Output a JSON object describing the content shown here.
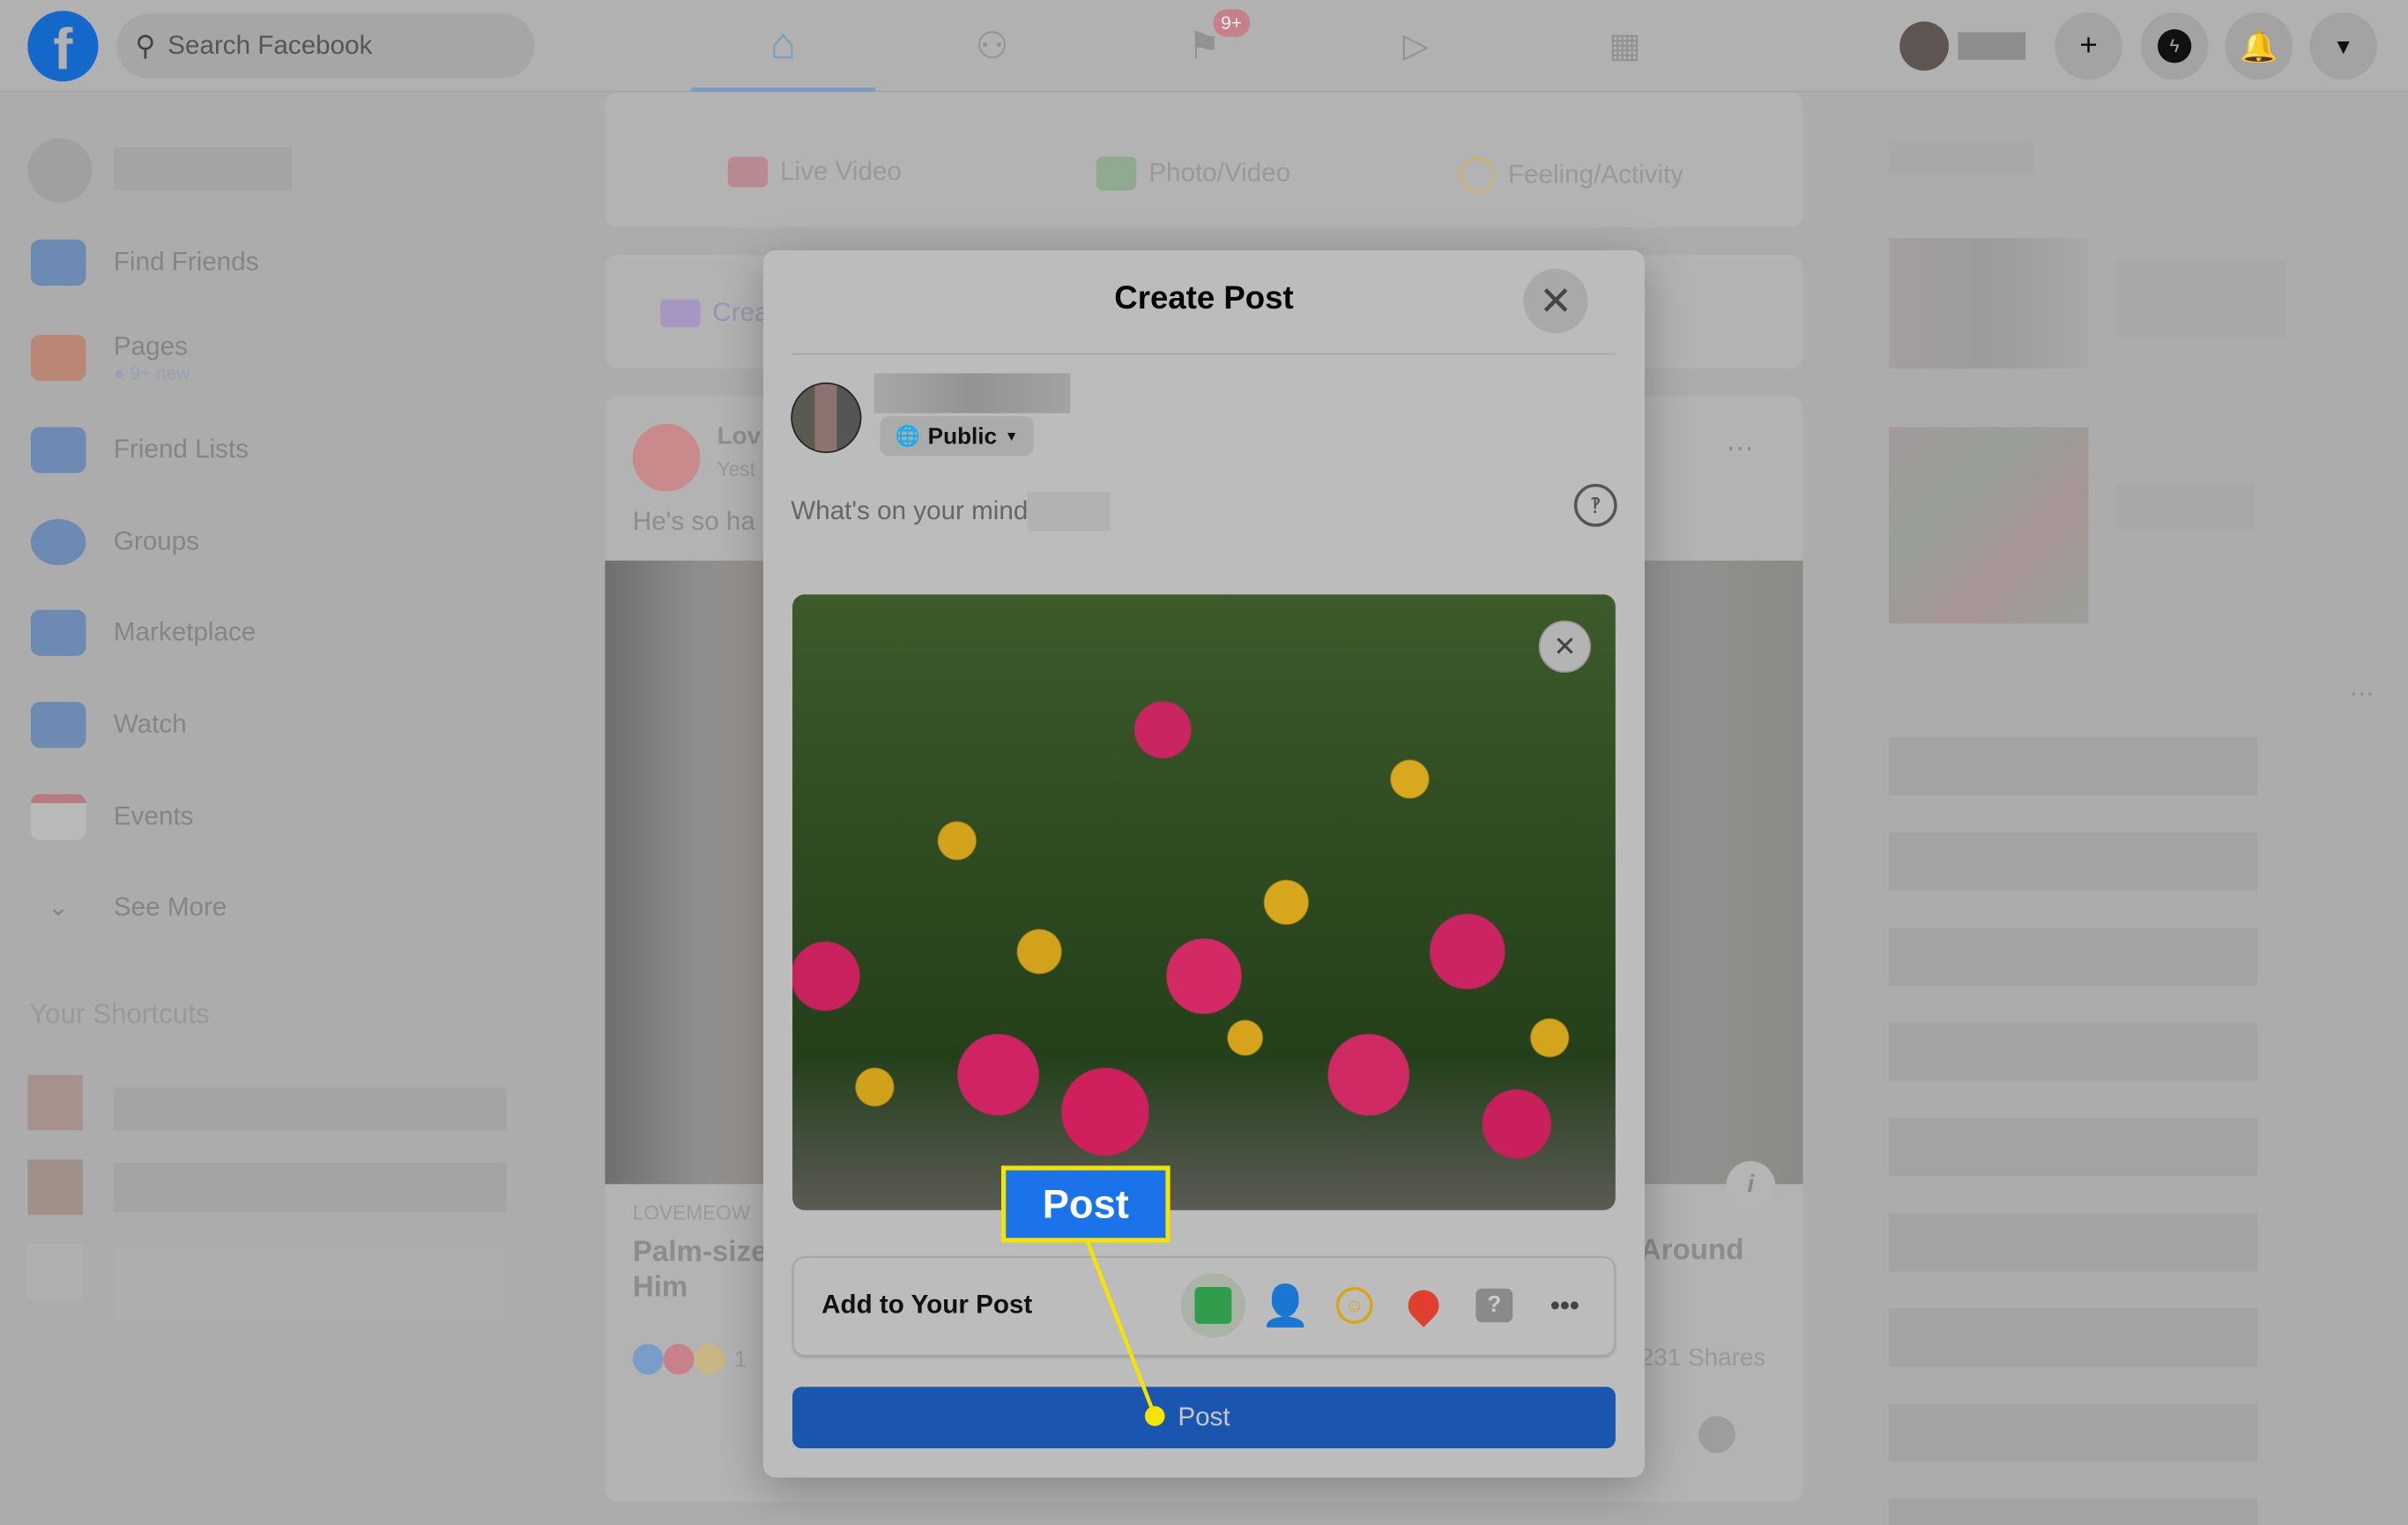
{
  "topbar": {
    "search_placeholder": "Search Facebook",
    "notif_badge": "9+"
  },
  "sidebar": {
    "items": [
      {
        "label": "Find Friends",
        "icon": "find-friends-icon",
        "color": "#1877f2"
      },
      {
        "label": "Pages",
        "sub": "9+ new",
        "icon": "flag-icon",
        "color": "#e4572e"
      },
      {
        "label": "Friend Lists",
        "icon": "friend-lists-icon",
        "color": "#1877f2"
      },
      {
        "label": "Groups",
        "icon": "groups-icon",
        "color": "#1877f2"
      },
      {
        "label": "Marketplace",
        "icon": "marketplace-icon",
        "color": "#1877f2"
      },
      {
        "label": "Watch",
        "icon": "watch-icon",
        "color": "#1877f2"
      },
      {
        "label": "Events",
        "icon": "events-icon",
        "color": "#e41e3f"
      }
    ],
    "see_more": "See More",
    "shortcuts_title": "Your Shortcuts"
  },
  "composer": {
    "live_video": "Live Video",
    "photo_video": "Photo/Video",
    "feeling": "Feeling/Activity",
    "create": "Crea"
  },
  "feed": {
    "post_author": "Lov",
    "post_time": "Yest",
    "post_text": "He's so ha",
    "source": "LOVEMEOW",
    "headline": "Palm-size",
    "headline2": "Him",
    "headline_right": "Around",
    "shares": "231 Shares",
    "reactions_count": "1"
  },
  "modal": {
    "title": "Create Post",
    "audience": "Public",
    "placeholder": "What's on your mind",
    "add_to_post": "Add to Your Post",
    "post_button": "Post"
  },
  "annotation": {
    "label": "Post",
    "box_color": "#1a73e8",
    "border_color": "#f5e400"
  },
  "colors": {
    "primary": "#1877f2",
    "post_button": "#1a56b0"
  }
}
